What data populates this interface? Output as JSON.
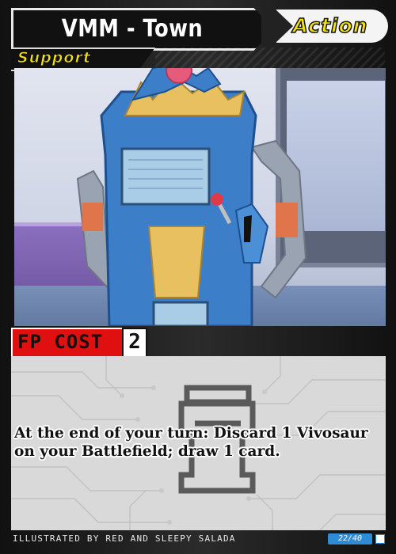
{
  "card": {
    "title": "VMM - Town",
    "type_label": "Action",
    "subtype_label": "Support",
    "fp_cost_label": "FP COST",
    "fp_cost_value": "2",
    "effect_text": "At the end of your turn: Discard 1 Vivosaur on your Battlefield; draw 1 card.",
    "illustrator_credit": "ILLUSTRATED BY RED AND SLEEPY SALADA",
    "card_number": "22/40"
  },
  "colors": {
    "action_text": "#f6e400",
    "fp_cost_bg": "#e01010",
    "number_badge": "#2e8bd6"
  },
  "icons": {
    "set_icon": "set-symbol-icon",
    "watermark": "stopwatch-watermark-icon"
  }
}
